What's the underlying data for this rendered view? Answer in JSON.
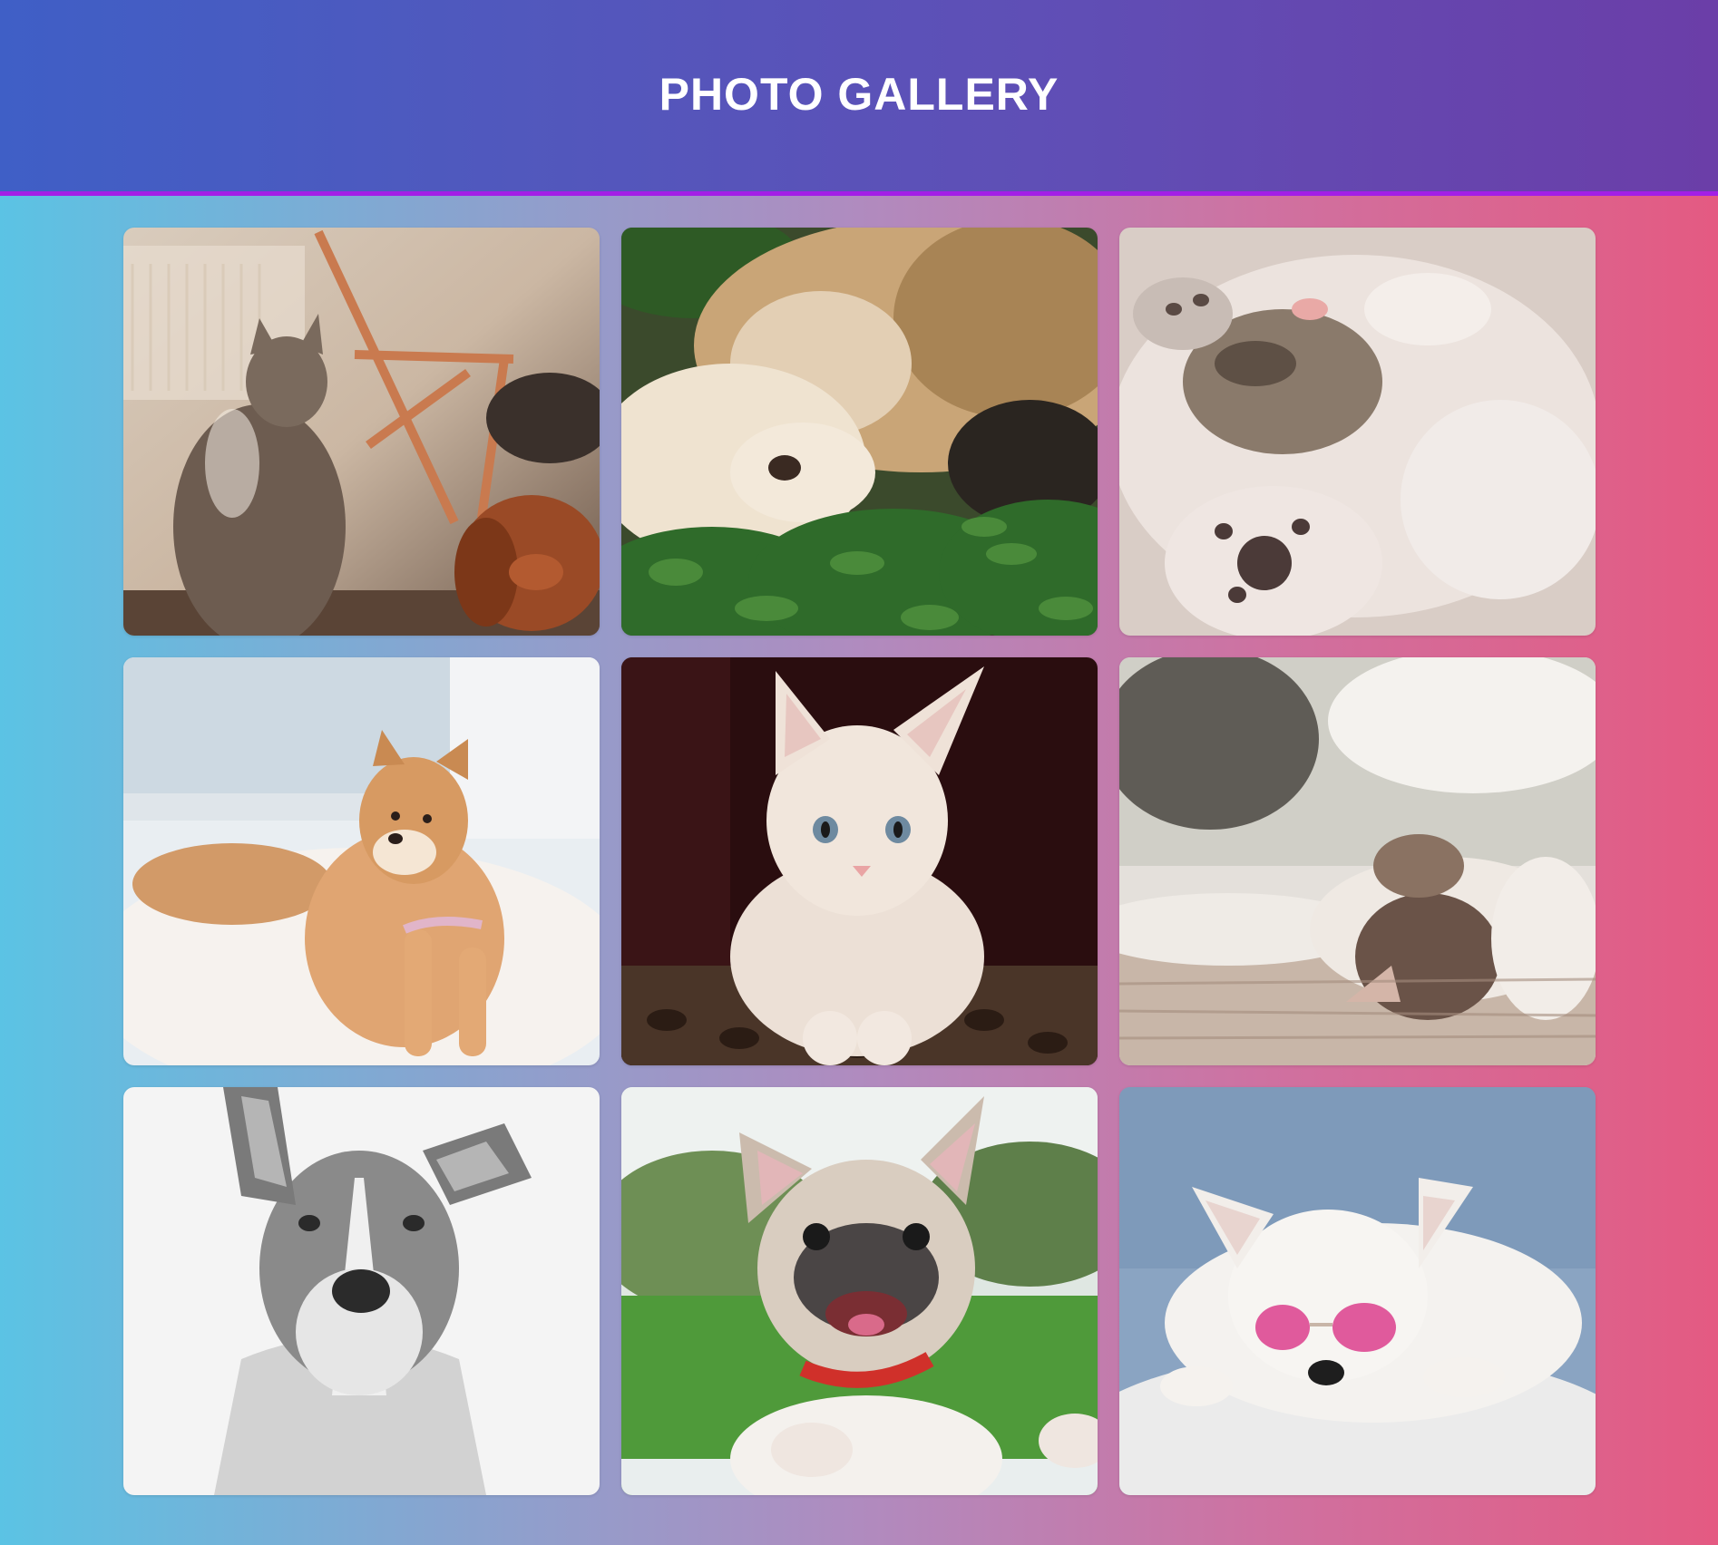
{
  "header": {
    "title": "PHOTO GALLERY"
  },
  "colors": {
    "header_gradient": [
      "#3f5fc6",
      "#6b3ea8"
    ],
    "header_border": "#a31fe6",
    "body_gradient": [
      "#5bc3e4",
      "#e45a82"
    ]
  },
  "gallery": {
    "photos": [
      {
        "subject": "cat-and-dog-indoors"
      },
      {
        "subject": "cat-and-puppy-cuddling"
      },
      {
        "subject": "kitten-sleeping-paws"
      },
      {
        "subject": "shiba-puppy-on-rug"
      },
      {
        "subject": "white-kitten-portrait"
      },
      {
        "subject": "cat-lying-on-back"
      },
      {
        "subject": "black-white-dog-portrait"
      },
      {
        "subject": "french-bulldog-smiling"
      },
      {
        "subject": "white-dog-pink-glasses"
      }
    ]
  }
}
